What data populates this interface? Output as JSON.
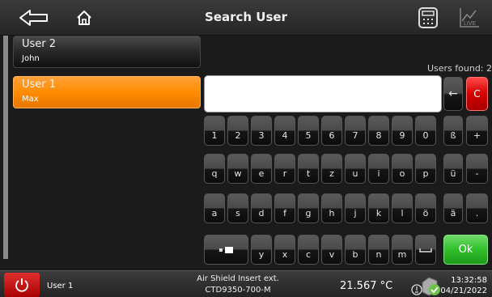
{
  "header": {
    "title": "Search User",
    "icons": [
      "back-arrow-icon",
      "home-icon",
      "calculator-icon",
      "live-chart-icon"
    ],
    "live_label": "LIVE"
  },
  "users": [
    {
      "name": "User 2",
      "first_name": "John",
      "selected": false
    },
    {
      "name": "User 1",
      "first_name": "Max",
      "selected": true
    }
  ],
  "users_found": "Users found: 2",
  "search": {
    "value": ""
  },
  "keyboard": {
    "row1": [
      "1",
      "2",
      "3",
      "4",
      "5",
      "6",
      "7",
      "8",
      "9",
      "0",
      "ß",
      "+"
    ],
    "row2": [
      "q",
      "w",
      "e",
      "r",
      "t",
      "z",
      "u",
      "i",
      "o",
      "p",
      "ü",
      "-"
    ],
    "row3": [
      "a",
      "s",
      "d",
      "f",
      "g",
      "h",
      "j",
      "k",
      "l",
      "ö",
      "ä",
      "."
    ],
    "row4": [
      "y",
      "x",
      "c",
      "v",
      "b",
      "n",
      "m"
    ],
    "backspace": "←",
    "clear": "C",
    "ok": "Ok",
    "space_symbol": "⎵"
  },
  "footer": {
    "user": "User 1",
    "device_line1": "Air Shield Insert ext.",
    "device_line2": "CTD9350-700-M",
    "temperature": "21.567 °C",
    "time": "13:32:58",
    "date": "04/21/2022"
  },
  "colors": {
    "selected": "#ff8c00",
    "clear": "#d40000",
    "ok": "#2fbf2a",
    "power": "#c00000"
  }
}
